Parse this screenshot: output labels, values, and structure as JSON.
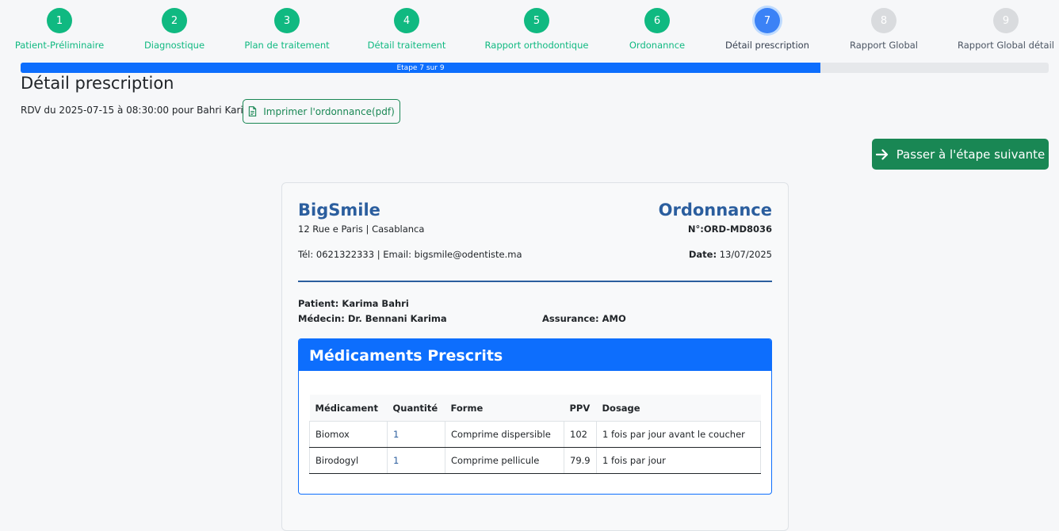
{
  "stepper": {
    "steps": [
      {
        "num": "1",
        "label": "Patient-Préliminaire",
        "state": "done"
      },
      {
        "num": "2",
        "label": "Diagnostique",
        "state": "done"
      },
      {
        "num": "3",
        "label": "Plan de traitement",
        "state": "done"
      },
      {
        "num": "4",
        "label": "Détail traitement",
        "state": "done"
      },
      {
        "num": "5",
        "label": "Rapport orthodontique",
        "state": "done"
      },
      {
        "num": "6",
        "label": "Ordonannce",
        "state": "done"
      },
      {
        "num": "7",
        "label": "Détail prescription",
        "state": "current"
      },
      {
        "num": "8",
        "label": "Rapport Global",
        "state": "todo"
      },
      {
        "num": "9",
        "label": "Rapport Global détail",
        "state": "todo"
      }
    ],
    "progress_label": "Etape 7 sur 9",
    "progress_fraction": 0.778
  },
  "page": {
    "title": "Détail prescription",
    "rdv_text": "RDV du 2025-07-15 à 08:30:00 pour Bahri Karima",
    "print_label": "Imprimer l'ordonnance(pdf)",
    "next_label": "Passer à l'étape suivante"
  },
  "ordonnance": {
    "clinic_name": "BigSmile",
    "address": "12 Rue e Paris | Casablanca",
    "contact": "Tél: 0621322333 | Email: bigsmile@odentiste.ma",
    "doc_title": "Ordonnance",
    "number": "N°:ORD-MD8036",
    "date_label": "Date:",
    "date_value": "13/07/2025",
    "patient": "Patient: Karima Bahri",
    "medecin": "Médecin: Dr. Bennani Karima",
    "assurance": "Assurance: AMO",
    "meds_title": "Médicaments Prescrits",
    "columns": [
      "Médicament",
      "Quantité",
      "Forme",
      "PPV",
      "Dosage"
    ],
    "rows": [
      [
        "Biomox",
        "1",
        "Comprime dispersible",
        "102",
        "1 fois par jour avant le coucher"
      ],
      [
        "Birodogyl",
        "1",
        "Comprime pellicule",
        "79.9",
        "1 fois par jour"
      ]
    ]
  },
  "colors": {
    "done": "#10b981",
    "current": "#3b82f6",
    "progress": "#0d6efd",
    "success_button": "#198754",
    "heading_blue": "#2b5e9e"
  },
  "icons": {
    "print": "file-text-icon",
    "next": "arrow-right-icon"
  }
}
